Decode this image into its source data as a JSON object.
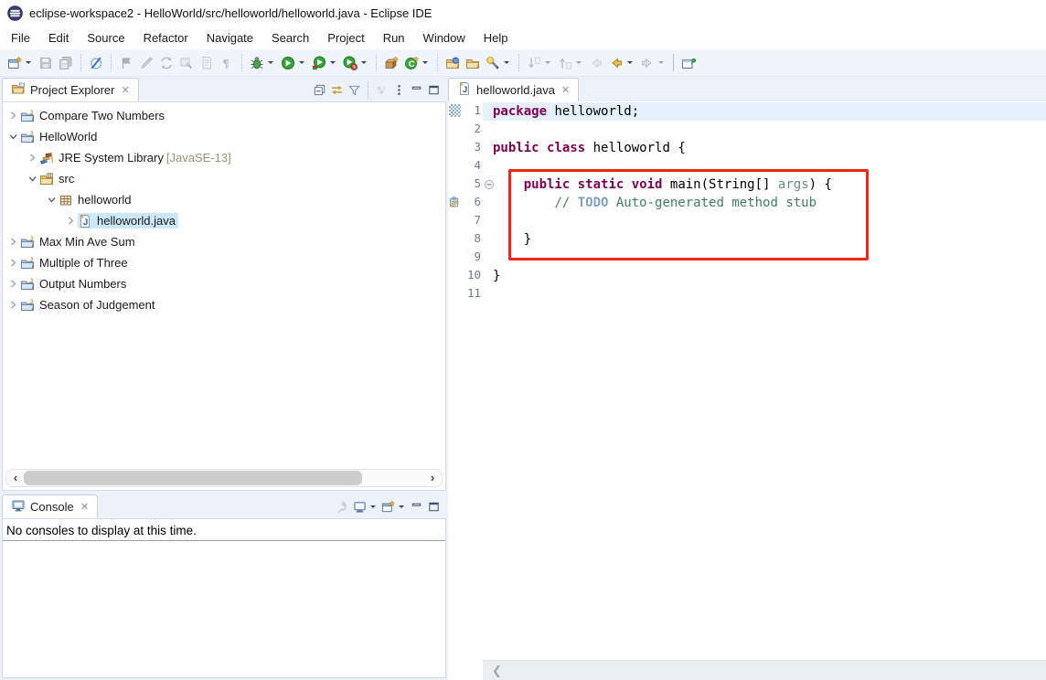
{
  "window": {
    "title": "eclipse-workspace2 - HelloWorld/src/helloworld/helloworld.java - Eclipse IDE"
  },
  "menu": {
    "items": [
      "File",
      "Edit",
      "Source",
      "Refactor",
      "Navigate",
      "Search",
      "Project",
      "Run",
      "Window",
      "Help"
    ]
  },
  "toolbar": {
    "items": [
      {
        "name": "new-wizard",
        "dropdown": true
      },
      {
        "name": "save",
        "disabled": true
      },
      {
        "name": "save-all",
        "disabled": true
      },
      {
        "sep": true
      },
      {
        "name": "skip-all-breakpoints"
      },
      {
        "sep": true
      },
      {
        "name": "launch-external-tools",
        "disabled": true
      },
      {
        "name": "format",
        "disabled": true
      },
      {
        "name": "synchronize",
        "disabled": true
      },
      {
        "name": "build-all",
        "disabled": true
      },
      {
        "name": "open-element",
        "disabled": true
      },
      {
        "name": "show-whitespace",
        "disabled": true
      },
      {
        "sep": true
      },
      {
        "name": "debug",
        "dropdown": true
      },
      {
        "name": "run",
        "dropdown": true
      },
      {
        "name": "coverage",
        "dropdown": true
      },
      {
        "name": "profile",
        "dropdown": true
      },
      {
        "sep": true
      },
      {
        "name": "new-java-project"
      },
      {
        "name": "new-java-class",
        "dropdown": true
      },
      {
        "sep": true
      },
      {
        "name": "open-type"
      },
      {
        "name": "open-resource"
      },
      {
        "name": "search",
        "dropdown": true
      },
      {
        "sep": true
      },
      {
        "name": "next-annotation",
        "disabled": true,
        "dropdown": true
      },
      {
        "name": "previous-annotation",
        "disabled": true,
        "dropdown": true
      },
      {
        "name": "last-edit-location",
        "disabled": true
      },
      {
        "name": "back",
        "dropdown": true
      },
      {
        "name": "forward",
        "disabled": true,
        "dropdown": true
      },
      {
        "sep": true,
        "solid": true
      },
      {
        "name": "pin-editor"
      }
    ]
  },
  "project_explorer": {
    "title": "Project Explorer",
    "toolbar": [
      {
        "name": "collapse-all"
      },
      {
        "name": "link-with-editor"
      },
      {
        "name": "filter"
      },
      {
        "sep": true
      },
      {
        "name": "focus-on-active-task",
        "disabled": true
      },
      {
        "name": "view-menu"
      },
      {
        "name": "minimize"
      },
      {
        "name": "maximize"
      }
    ],
    "tree": [
      {
        "depth": 0,
        "expander": "collapsed",
        "icon": "java-project",
        "label": "Compare Two Numbers"
      },
      {
        "depth": 0,
        "expander": "expanded",
        "icon": "java-project",
        "label": "HelloWorld"
      },
      {
        "depth": 1,
        "expander": "collapsed",
        "icon": "jre-library",
        "label": "JRE System Library",
        "suffix": " [JavaSE-13]"
      },
      {
        "depth": 1,
        "expander": "expanded",
        "icon": "src-folder",
        "label": "src"
      },
      {
        "depth": 2,
        "expander": "expanded",
        "icon": "package",
        "label": "helloworld"
      },
      {
        "depth": 3,
        "expander": "collapsed",
        "icon": "java-file",
        "label": "helloworld.java",
        "selected": true
      },
      {
        "depth": 0,
        "expander": "collapsed",
        "icon": "java-project",
        "label": "Max Min Ave Sum"
      },
      {
        "depth": 0,
        "expander": "collapsed",
        "icon": "java-project",
        "label": "Multiple of Three"
      },
      {
        "depth": 0,
        "expander": "collapsed",
        "icon": "java-project",
        "label": "Output Numbers"
      },
      {
        "depth": 0,
        "expander": "collapsed",
        "icon": "java-project",
        "label": "Season of Judgement"
      }
    ]
  },
  "editor": {
    "tab_label": "helloworld.java",
    "lines": [
      {
        "n": 1,
        "highlight": true,
        "ruler": "range",
        "tokens": [
          {
            "c": "kw",
            "t": "package"
          },
          {
            "c": "pl",
            "t": " helloworld;"
          }
        ]
      },
      {
        "n": 2,
        "tokens": []
      },
      {
        "n": 3,
        "tokens": [
          {
            "c": "kw",
            "t": "public"
          },
          {
            "c": "pl",
            "t": " "
          },
          {
            "c": "kw",
            "t": "class"
          },
          {
            "c": "pl",
            "t": " helloworld {"
          }
        ]
      },
      {
        "n": 4,
        "tokens": []
      },
      {
        "n": 5,
        "fold": true,
        "tokens": [
          {
            "c": "pl",
            "t": "\t"
          },
          {
            "c": "kw",
            "t": "public"
          },
          {
            "c": "pl",
            "t": " "
          },
          {
            "c": "kw",
            "t": "static"
          },
          {
            "c": "pl",
            "t": " "
          },
          {
            "c": "kw",
            "t": "void"
          },
          {
            "c": "pl",
            "t": " main(String[] "
          },
          {
            "c": "param",
            "t": "args"
          },
          {
            "c": "pl",
            "t": ") {"
          }
        ]
      },
      {
        "n": 6,
        "ruler": "task",
        "tokens": [
          {
            "c": "pl",
            "t": "\t\t"
          },
          {
            "c": "cm",
            "t": "// "
          },
          {
            "c": "todo",
            "t": "TODO"
          },
          {
            "c": "cm",
            "t": " Auto-generated method stub"
          }
        ]
      },
      {
        "n": 7,
        "tokens": []
      },
      {
        "n": 8,
        "tokens": [
          {
            "c": "pl",
            "t": "\t}"
          }
        ]
      },
      {
        "n": 9,
        "tokens": []
      },
      {
        "n": 10,
        "tokens": [
          {
            "c": "pl",
            "t": "}"
          }
        ]
      },
      {
        "n": 11,
        "tokens": []
      }
    ]
  },
  "console": {
    "title": "Console",
    "toolbar": [
      {
        "name": "pin-console",
        "disabled": true
      },
      {
        "name": "display-selected-console",
        "dropdown": true
      },
      {
        "name": "open-console",
        "dropdown": true
      },
      {
        "name": "minimize"
      },
      {
        "name": "maximize"
      }
    ],
    "message": "No consoles to display at this time."
  },
  "colors": {
    "keyword": "#7f0055",
    "comment": "#3f7f5f",
    "todo": "#7f9fbf",
    "param": "#6e8b8b",
    "selection": "#cbe7fa",
    "line_highlight": "#e4effb",
    "highlight_box": "#f02718"
  }
}
